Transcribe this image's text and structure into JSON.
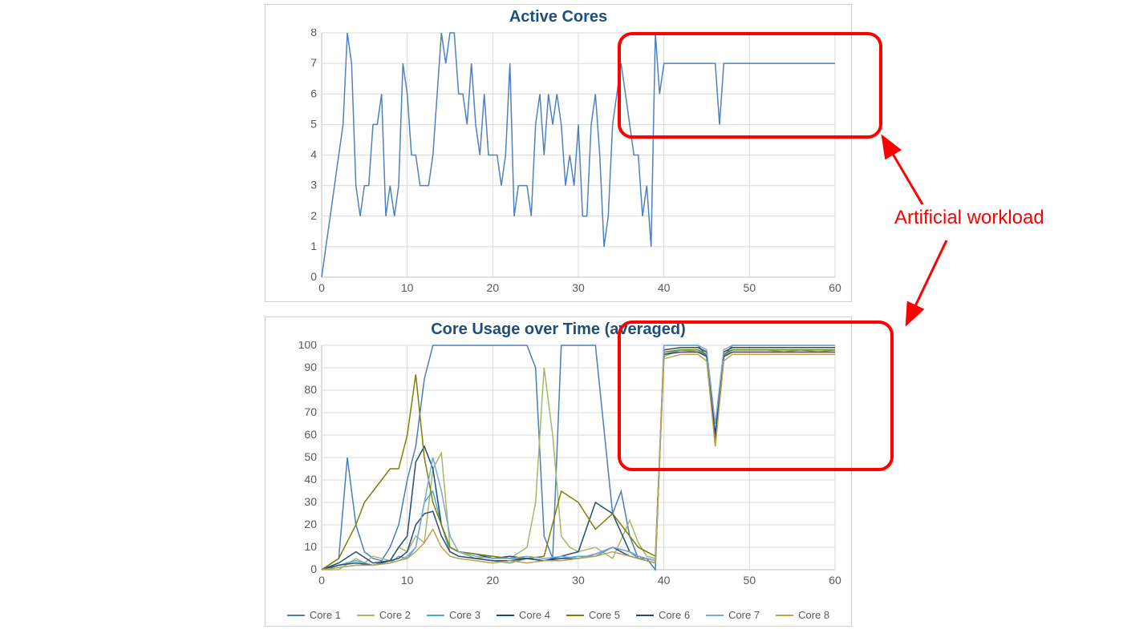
{
  "chart_data": [
    {
      "id": "active_cores",
      "type": "line",
      "title": "Active Cores",
      "xlabel": "",
      "ylabel": "",
      "xlim": [
        0,
        60
      ],
      "ylim": [
        0,
        8
      ],
      "x_ticks": [
        0,
        10,
        20,
        30,
        40,
        50,
        60
      ],
      "y_ticks": [
        0,
        1,
        2,
        3,
        4,
        5,
        6,
        7,
        8
      ],
      "grid": true,
      "series": [
        {
          "name": "Active Cores",
          "color": "#4f81bd",
          "x": [
            0,
            0.5,
            1,
            1.5,
            2,
            2.5,
            3,
            3.5,
            4,
            4.5,
            5,
            5.5,
            6,
            6.5,
            7,
            7.5,
            8,
            8.5,
            9,
            9.5,
            10,
            10.5,
            11,
            11.5,
            12,
            12.5,
            13,
            13.5,
            14,
            14.5,
            15,
            15.5,
            16,
            16.5,
            17,
            17.5,
            18,
            18.5,
            19,
            19.5,
            20,
            20.5,
            21,
            21.5,
            22,
            22.5,
            23,
            23.5,
            24,
            24.5,
            25,
            25.5,
            26,
            26.5,
            27,
            27.5,
            28,
            28.5,
            29,
            29.5,
            30,
            30.5,
            31,
            31.5,
            32,
            32.5,
            33,
            33.5,
            34,
            34.5,
            35,
            35.5,
            36,
            36.5,
            37,
            37.5,
            38,
            38.5,
            39,
            39.5,
            40,
            41,
            42,
            43,
            44,
            45,
            46,
            46.5,
            47,
            48,
            49,
            50,
            51,
            52,
            53,
            54,
            55,
            56,
            57,
            58,
            59,
            60
          ],
          "values": [
            0,
            1,
            2,
            3,
            4,
            5,
            8,
            7,
            3,
            2,
            3,
            3,
            5,
            5,
            6,
            2,
            3,
            2,
            3,
            7,
            6,
            4,
            4,
            3,
            3,
            3,
            4,
            6,
            8,
            7,
            8,
            8,
            6,
            6,
            5,
            7,
            5,
            4,
            6,
            4,
            4,
            4,
            3,
            4,
            7,
            2,
            3,
            3,
            3,
            2,
            5,
            6,
            4,
            6,
            5,
            6,
            5,
            3,
            4,
            3,
            5,
            2,
            2,
            5,
            6,
            4,
            1,
            2,
            5,
            6,
            7,
            6,
            5,
            4,
            4,
            2,
            3,
            1,
            8,
            6,
            7,
            7,
            7,
            7,
            7,
            7,
            7,
            5,
            7,
            7,
            7,
            7,
            7,
            7,
            7,
            7,
            7,
            7,
            7,
            7,
            7,
            7
          ]
        }
      ]
    },
    {
      "id": "core_usage",
      "type": "line",
      "title": "Core Usage over Time (averaged)",
      "xlabel": "",
      "ylabel": "",
      "xlim": [
        0,
        60
      ],
      "ylim": [
        0,
        100
      ],
      "x_ticks": [
        0,
        10,
        20,
        30,
        40,
        50,
        60
      ],
      "y_ticks": [
        0,
        10,
        20,
        30,
        40,
        50,
        60,
        70,
        80,
        90,
        100
      ],
      "grid": true,
      "legend_position": "bottom",
      "series": [
        {
          "name": "Core 1",
          "color": "#4a7ebb",
          "x": [
            0,
            2,
            3,
            4,
            5,
            6,
            7,
            8,
            9,
            10,
            11,
            12,
            13,
            14,
            15,
            16,
            17,
            18,
            20,
            22,
            24,
            25,
            26,
            27,
            28,
            30,
            32,
            34,
            35,
            36,
            37,
            38,
            39,
            40,
            42,
            44,
            45,
            46,
            47,
            48,
            50,
            52,
            54,
            56,
            58,
            60
          ],
          "values": [
            0,
            5,
            50,
            20,
            8,
            5,
            4,
            10,
            20,
            40,
            55,
            85,
            100,
            100,
            100,
            100,
            100,
            100,
            100,
            100,
            100,
            90,
            15,
            5,
            100,
            100,
            100,
            25,
            35,
            15,
            5,
            5,
            0,
            100,
            100,
            100,
            95,
            60,
            95,
            100,
            100,
            100,
            100,
            100,
            100,
            100
          ]
        },
        {
          "name": "Core 2",
          "color": "#a2b969",
          "x": [
            0,
            2,
            4,
            5,
            6,
            7,
            8,
            9,
            10,
            11,
            12,
            13,
            14,
            15,
            16,
            18,
            20,
            22,
            24,
            25,
            26,
            27,
            28,
            29,
            30,
            32,
            34,
            36,
            37,
            38,
            39,
            40,
            42,
            44,
            45,
            46,
            47,
            48,
            50,
            52,
            54,
            56,
            58,
            60
          ],
          "values": [
            0,
            0,
            5,
            3,
            6,
            5,
            4,
            10,
            8,
            15,
            12,
            45,
            52,
            10,
            8,
            5,
            6,
            5,
            10,
            30,
            90,
            60,
            15,
            10,
            8,
            10,
            5,
            22,
            12,
            6,
            5,
            95,
            98,
            97,
            95,
            60,
            95,
            98,
            98,
            98,
            97,
            98,
            97,
            98
          ]
        },
        {
          "name": "Core 3",
          "color": "#4bacc6",
          "x": [
            0,
            2,
            4,
            6,
            8,
            9,
            10,
            11,
            12,
            13,
            14,
            15,
            16,
            18,
            20,
            22,
            24,
            26,
            28,
            30,
            32,
            34,
            36,
            37,
            38,
            39,
            40,
            42,
            44,
            45,
            46,
            47,
            48,
            50,
            52,
            54,
            56,
            58,
            60
          ],
          "values": [
            0,
            2,
            4,
            2,
            3,
            6,
            5,
            10,
            30,
            35,
            20,
            8,
            6,
            5,
            4,
            3,
            5,
            4,
            5,
            6,
            6,
            10,
            8,
            5,
            4,
            3,
            96,
            98,
            98,
            95,
            58,
            96,
            98,
            98,
            98,
            98,
            98,
            98,
            98
          ]
        },
        {
          "name": "Core 4",
          "color": "#1f4e79",
          "x": [
            0,
            2,
            4,
            6,
            8,
            9,
            10,
            11,
            12,
            13,
            14,
            15,
            16,
            18,
            20,
            22,
            24,
            26,
            28,
            30,
            32,
            34,
            36,
            37,
            38,
            39,
            40,
            42,
            44,
            45,
            46,
            47,
            48,
            50,
            52,
            54,
            56,
            58,
            60
          ],
          "values": [
            0,
            3,
            8,
            3,
            4,
            10,
            15,
            48,
            55,
            45,
            20,
            10,
            8,
            7,
            5,
            6,
            5,
            4,
            6,
            8,
            30,
            25,
            8,
            6,
            5,
            4,
            98,
            99,
            99,
            97,
            60,
            97,
            99,
            99,
            99,
            99,
            99,
            99,
            99
          ]
        },
        {
          "name": "Core 5",
          "color": "#808000",
          "x": [
            0,
            2,
            4,
            5,
            6,
            7,
            8,
            9,
            10,
            11,
            12,
            13,
            14,
            15,
            16,
            18,
            20,
            22,
            24,
            26,
            28,
            30,
            32,
            34,
            36,
            37,
            38,
            39,
            40,
            42,
            44,
            45,
            46,
            47,
            48,
            50,
            52,
            54,
            56,
            58,
            60
          ],
          "values": [
            0,
            5,
            20,
            30,
            35,
            40,
            45,
            45,
            60,
            87,
            50,
            30,
            20,
            10,
            8,
            7,
            6,
            5,
            5,
            6,
            35,
            30,
            18,
            25,
            15,
            10,
            8,
            6,
            97,
            98,
            98,
            96,
            55,
            96,
            98,
            98,
            98,
            98,
            98,
            98,
            98
          ]
        },
        {
          "name": "Core 6",
          "color": "#2e4a7d",
          "x": [
            0,
            2,
            4,
            6,
            8,
            9,
            10,
            11,
            12,
            13,
            14,
            15,
            16,
            18,
            20,
            22,
            24,
            26,
            28,
            30,
            32,
            34,
            36,
            37,
            38,
            39,
            40,
            42,
            44,
            45,
            46,
            47,
            48,
            50,
            52,
            54,
            56,
            58,
            60
          ],
          "values": [
            0,
            2,
            3,
            2,
            4,
            5,
            8,
            20,
            25,
            26,
            15,
            8,
            6,
            5,
            4,
            4,
            5,
            4,
            5,
            5,
            7,
            10,
            6,
            5,
            4,
            3,
            96,
            97,
            97,
            95,
            57,
            95,
            97,
            97,
            97,
            97,
            97,
            97,
            97
          ]
        },
        {
          "name": "Core 7",
          "color": "#7ba7d7",
          "x": [
            0,
            2,
            4,
            6,
            8,
            9,
            10,
            11,
            12,
            13,
            14,
            15,
            16,
            18,
            20,
            22,
            24,
            26,
            28,
            30,
            32,
            34,
            36,
            37,
            38,
            39,
            40,
            42,
            44,
            45,
            46,
            47,
            48,
            50,
            52,
            54,
            56,
            58,
            60
          ],
          "values": [
            0,
            1,
            2,
            2,
            3,
            4,
            6,
            10,
            30,
            50,
            35,
            15,
            8,
            6,
            5,
            5,
            6,
            5,
            6,
            5,
            7,
            10,
            8,
            6,
            5,
            4,
            100,
            100,
            100,
            98,
            65,
            98,
            100,
            100,
            100,
            100,
            100,
            100,
            100
          ]
        },
        {
          "name": "Core 8",
          "color": "#bfa14a",
          "x": [
            0,
            2,
            4,
            6,
            8,
            9,
            10,
            11,
            12,
            13,
            14,
            15,
            16,
            18,
            20,
            22,
            24,
            26,
            28,
            30,
            32,
            34,
            36,
            37,
            38,
            39,
            40,
            42,
            44,
            45,
            46,
            47,
            48,
            50,
            52,
            54,
            56,
            58,
            60
          ],
          "values": [
            0,
            1,
            2,
            2,
            3,
            4,
            5,
            8,
            12,
            18,
            10,
            6,
            5,
            4,
            3,
            4,
            3,
            4,
            4,
            5,
            6,
            8,
            6,
            5,
            4,
            3,
            94,
            96,
            96,
            93,
            55,
            93,
            96,
            96,
            96,
            96,
            96,
            96,
            96
          ]
        }
      ]
    }
  ],
  "annotation": {
    "text": "Artificial workload",
    "color": "#ff0000"
  },
  "highlight_boxes": [
    {
      "target": "active_cores_right"
    },
    {
      "target": "core_usage_right"
    }
  ]
}
